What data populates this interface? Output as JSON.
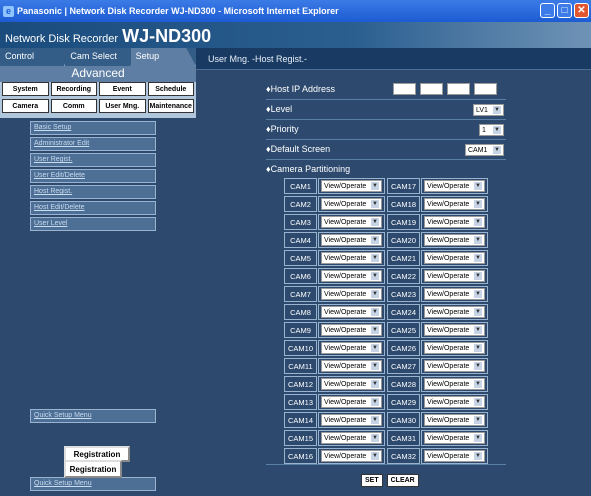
{
  "window": {
    "title": "Panasonic | Network Disk Recorder WJ-ND300 - Microsoft Internet Explorer"
  },
  "app": {
    "title_small": "Network Disk Recorder",
    "title_big": "WJ-ND300"
  },
  "tabs": [
    {
      "label": "Control"
    },
    {
      "label": "Cam Select"
    },
    {
      "label": "Setup"
    }
  ],
  "advanced_label": "Advanced",
  "menu_buttons": [
    {
      "label": "System"
    },
    {
      "label": "Recording"
    },
    {
      "label": "Event"
    },
    {
      "label": "Schedule"
    },
    {
      "label": "Camera"
    },
    {
      "label": "Comm"
    },
    {
      "label": "User Mng."
    },
    {
      "label": "Maintenance"
    }
  ],
  "submenu": [
    {
      "label": "Basic Setup"
    },
    {
      "label": "Administrator Edit"
    },
    {
      "label": "User Regist."
    },
    {
      "label": "User Edit/Delete"
    },
    {
      "label": "Host Regist."
    },
    {
      "label": "Host Edit/Delete"
    },
    {
      "label": "User Level"
    }
  ],
  "quick_setup_label": "Quick Setup Menu",
  "registration_label": "Registration",
  "main": {
    "header": "User Mng. -Host Regist.-",
    "host_ip_label": "♦Host IP Address",
    "level_label": "♦Level",
    "level_value": "LV1",
    "priority_label": "♦Priority",
    "priority_value": "1",
    "default_screen_label": "♦Default Screen",
    "default_screen_value": "CAM1",
    "camera_partitioning_label": "♦Camera Partitioning",
    "cameras": [
      "CAM1",
      "CAM2",
      "CAM3",
      "CAM4",
      "CAM5",
      "CAM6",
      "CAM7",
      "CAM8",
      "CAM9",
      "CAM10",
      "CAM11",
      "CAM12",
      "CAM13",
      "CAM14",
      "CAM15",
      "CAM16",
      "CAM17",
      "CAM18",
      "CAM19",
      "CAM20",
      "CAM21",
      "CAM22",
      "CAM23",
      "CAM24",
      "CAM25",
      "CAM26",
      "CAM27",
      "CAM28",
      "CAM29",
      "CAM30",
      "CAM31",
      "CAM32"
    ],
    "permission_value": "View/Operate",
    "set_label": "SET",
    "clear_label": "CLEAR"
  },
  "colors": {
    "panel_bg": "#2d4a6e",
    "left_bg": "#b0c6dc",
    "header_bg": "#193b63"
  }
}
